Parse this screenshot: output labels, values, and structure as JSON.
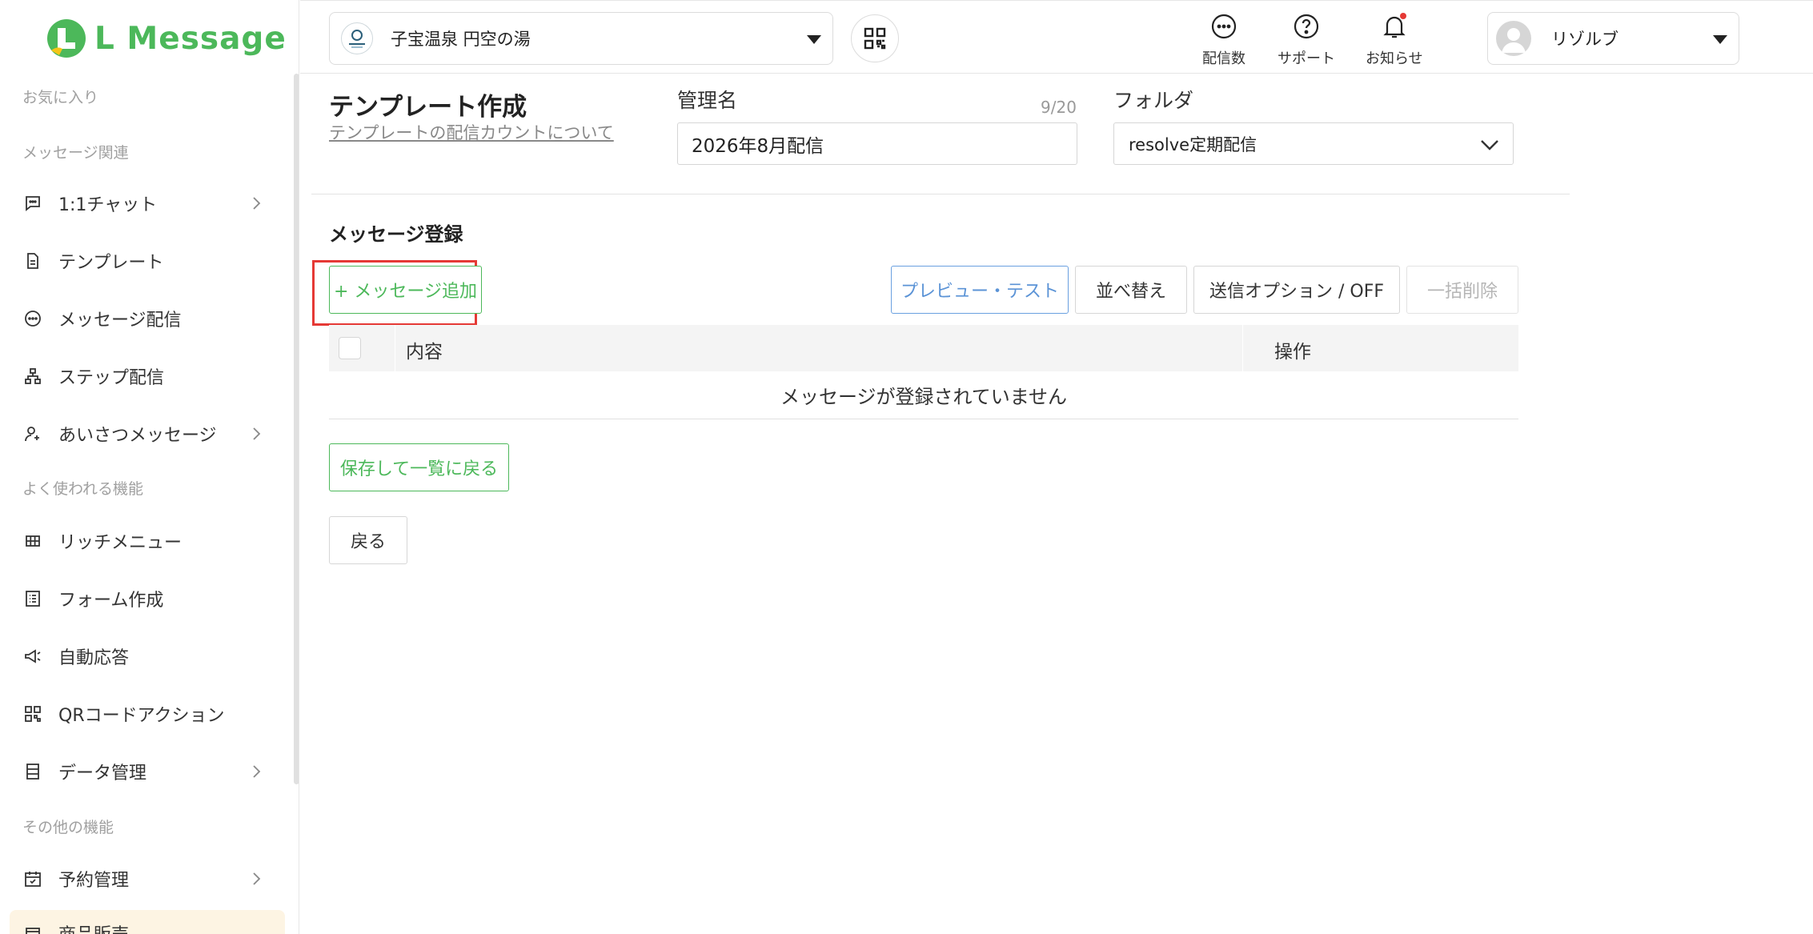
{
  "app": {
    "logo_text": "L Message",
    "brand_color": "#4cb85a"
  },
  "sidebar": {
    "sections": {
      "favorites": "お気に入り",
      "message": "メッセージ関連",
      "common": "よく使われる機能",
      "other": "その他の機能"
    },
    "items": [
      {
        "label": "1:1チャット",
        "icon": "chat-bubble-icon",
        "has_children": true
      },
      {
        "label": "テンプレート",
        "icon": "document-icon",
        "has_children": false
      },
      {
        "label": "メッセージ配信",
        "icon": "message-icon",
        "has_children": false
      },
      {
        "label": "ステップ配信",
        "icon": "hierarchy-icon",
        "has_children": false
      },
      {
        "label": "あいさつメッセージ",
        "icon": "user-add-icon",
        "has_children": true
      },
      {
        "label": "リッチメニュー",
        "icon": "grid-icon",
        "has_children": false
      },
      {
        "label": "フォーム作成",
        "icon": "form-icon",
        "has_children": false
      },
      {
        "label": "自動応答",
        "icon": "megaphone-icon",
        "has_children": false
      },
      {
        "label": "QRコードアクション",
        "icon": "qr-code-icon",
        "has_children": false
      },
      {
        "label": "データ管理",
        "icon": "database-icon",
        "has_children": true
      },
      {
        "label": "予約管理",
        "icon": "calendar-check-icon",
        "has_children": true
      },
      {
        "label": "商品販売",
        "icon": "shop-icon",
        "has_children": false
      }
    ]
  },
  "topbar": {
    "account_name": "子宝温泉 円空の湯",
    "delivery_count_label": "配信数",
    "support_label": "サポート",
    "notifications_label": "お知らせ",
    "user_name": "リゾルブ",
    "notification_dot_color": "#e53935"
  },
  "form": {
    "page_title": "テンプレート作成",
    "count_link": "テンプレートの配信カウントについて",
    "name_label": "管理名",
    "name_value": "2026年8月配信",
    "name_count": "9/20",
    "folder_label": "フォルダ",
    "folder_value": "resolve定期配信"
  },
  "messages": {
    "section_title": "メッセージ登録",
    "add_button": "+ メッセージ追加",
    "preview_button": "プレビュー・テスト",
    "sort_button": "並べ替え",
    "option_button": "送信オプション / OFF",
    "bulk_delete_button": "一括削除",
    "col_content": "内容",
    "col_actions": "操作",
    "empty_text": "メッセージが登録されていません"
  },
  "footer": {
    "save_button": "保存して一覧に戻る",
    "back_button": "戻る"
  }
}
